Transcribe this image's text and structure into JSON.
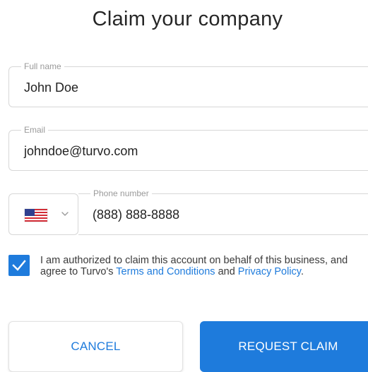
{
  "title": "Claim your company",
  "fields": {
    "full_name": {
      "label": "Full name",
      "value": "John Doe"
    },
    "email": {
      "label": "Email",
      "value": "johndoe@turvo.com"
    },
    "phone": {
      "label": "Phone number",
      "value": "(888) 888-8888",
      "country_flag": "us-flag-icon"
    }
  },
  "consent": {
    "checked": true,
    "text_before": "I am authorized to claim this account on behalf of this business, and agree to Turvo's ",
    "terms_link": "Terms and Conditions",
    "text_middle": " and ",
    "privacy_link": "Privacy Policy",
    "text_after": "."
  },
  "buttons": {
    "cancel": "CANCEL",
    "request": "REQUEST CLAIM"
  },
  "colors": {
    "accent": "#1e7bdc",
    "border": "#d7d7d7",
    "label": "#9a9a9a"
  }
}
